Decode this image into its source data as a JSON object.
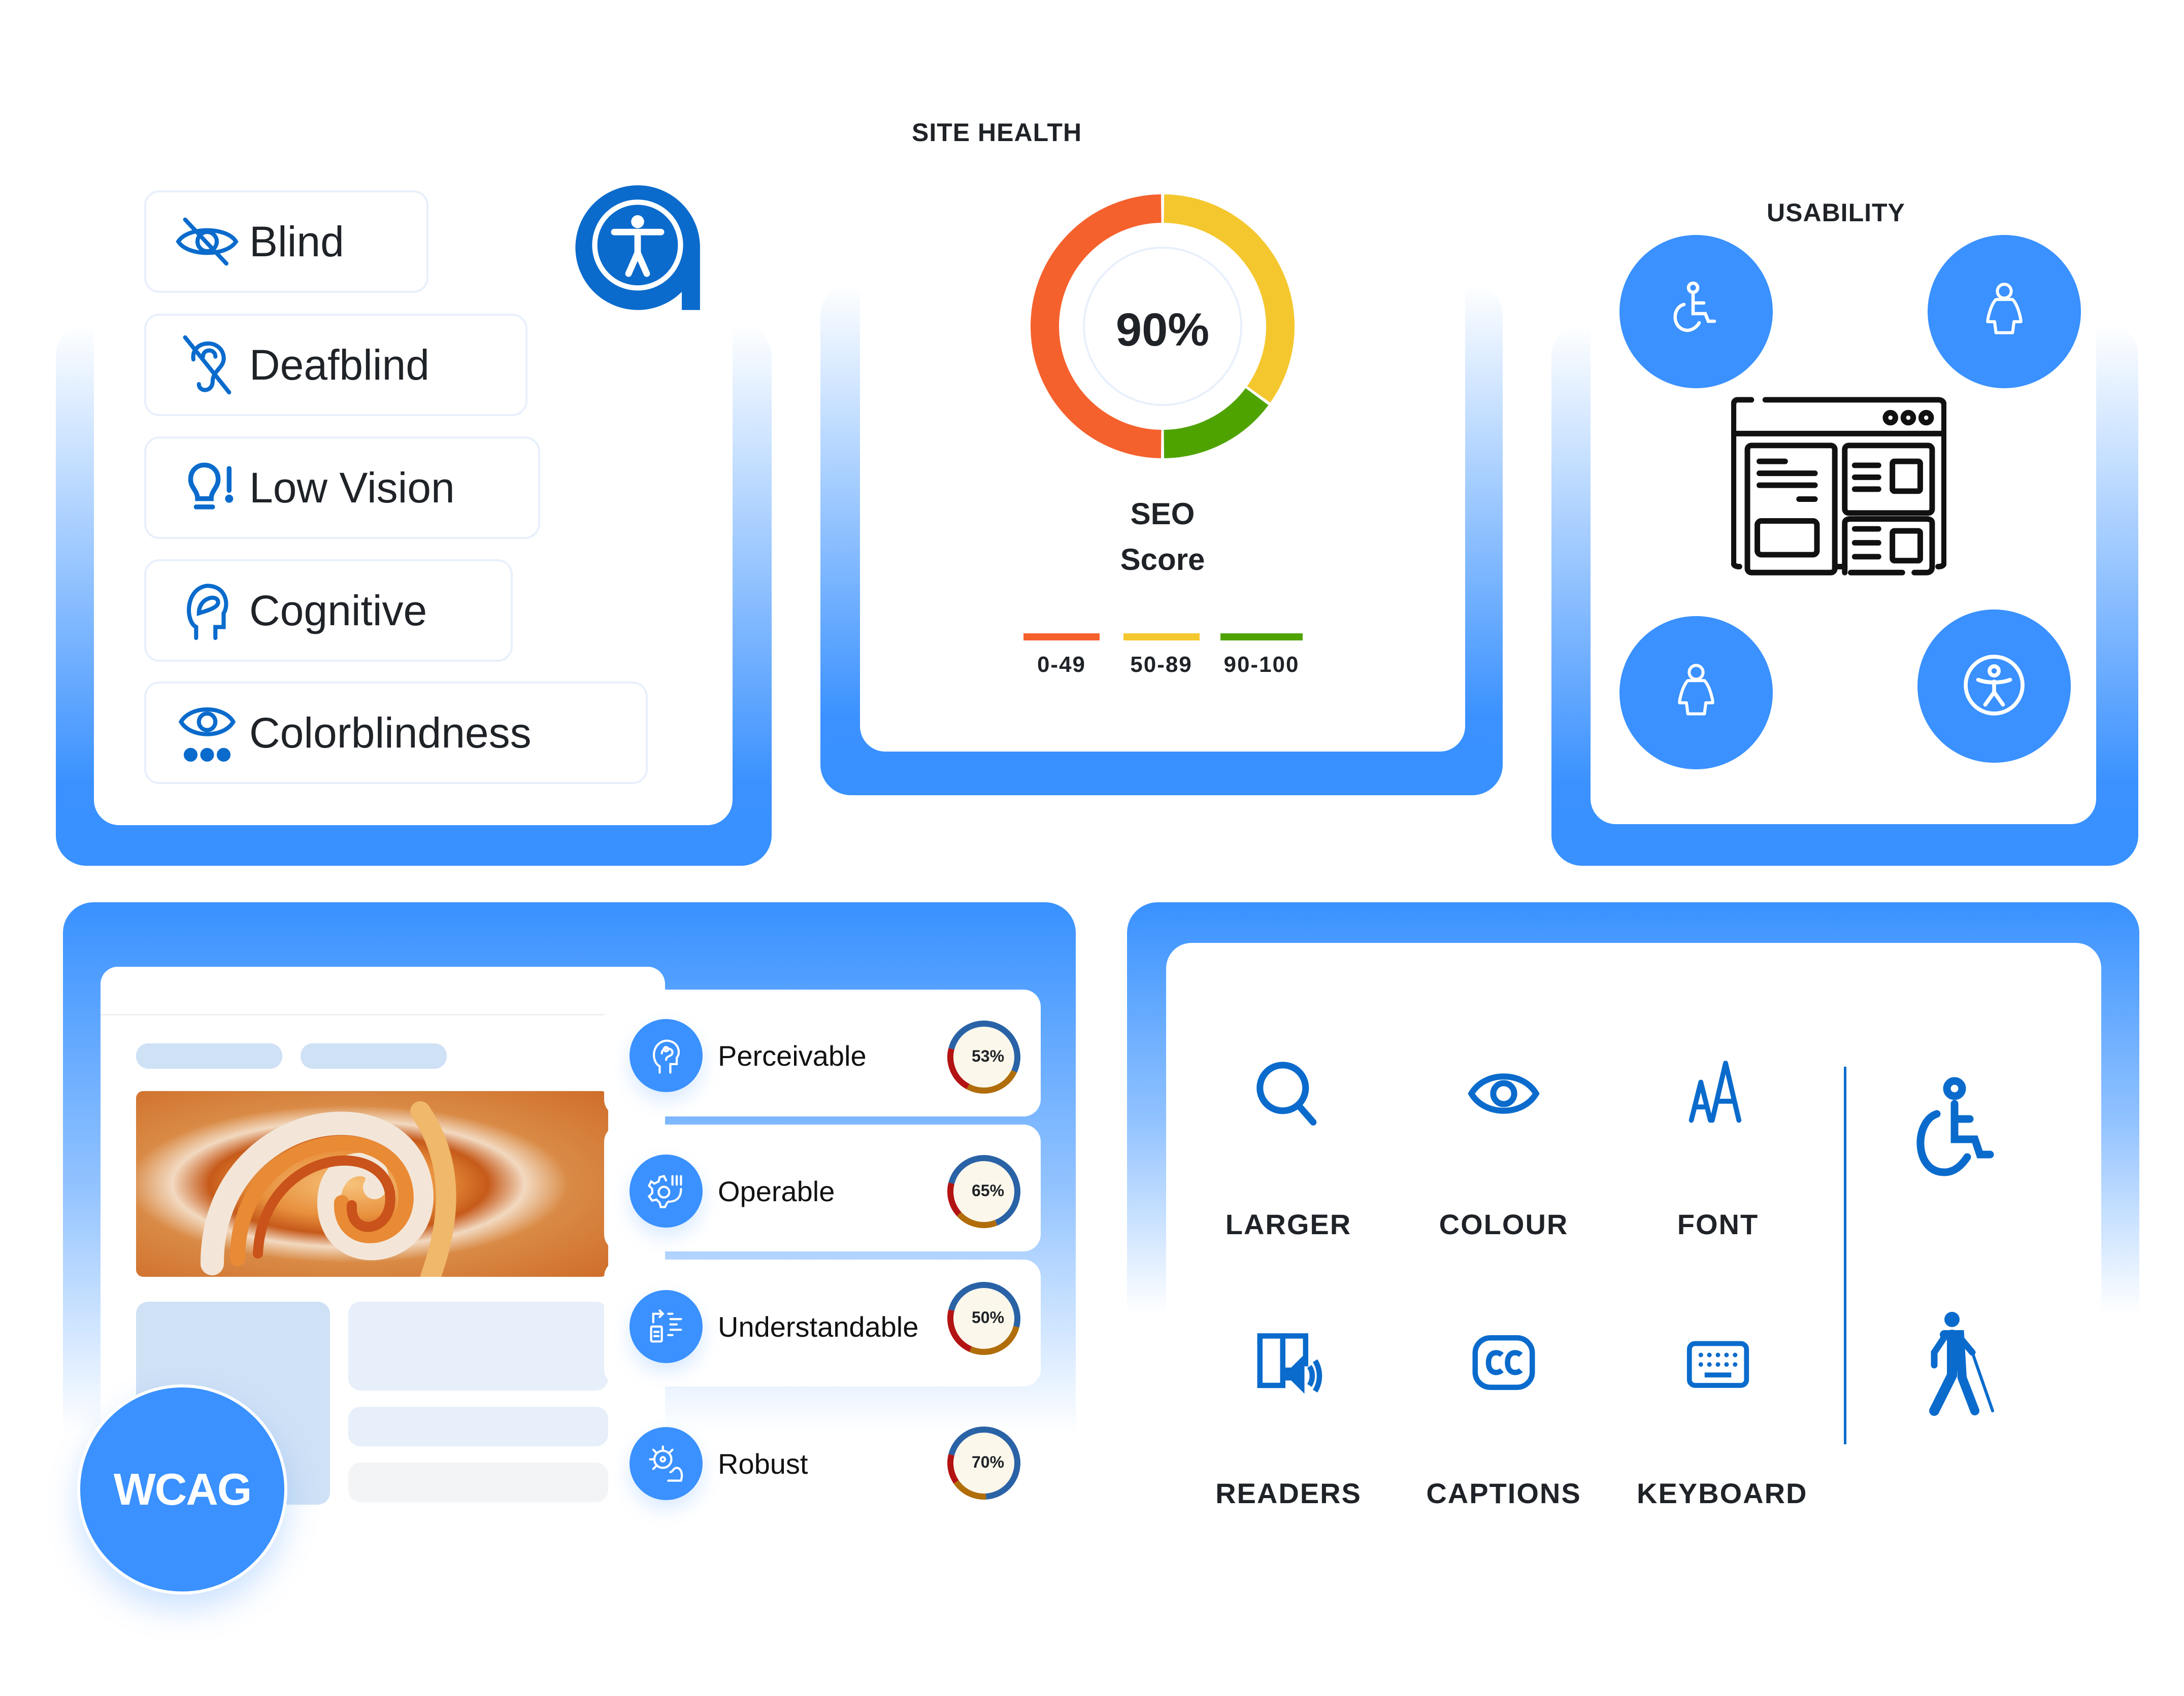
{
  "disabilities": {
    "items": [
      {
        "label": "Blind",
        "icon": "eye-slash-icon"
      },
      {
        "label": "Deafblind",
        "icon": "ear-slash-icon"
      },
      {
        "label": "Low Vision",
        "icon": "lightbulb-exclamation-icon"
      },
      {
        "label": "Cognitive",
        "icon": "head-brain-icon"
      },
      {
        "label": "Colorblindness",
        "icon": "eye-dots-icon"
      }
    ],
    "logo_icon": "accessibility-logo-icon"
  },
  "site_health": {
    "title": "SITE HEALTH",
    "score_text": "90%",
    "score_label_line1": "SEO",
    "score_label_line2": "Score",
    "legend": [
      {
        "label": "0-49",
        "color": "#f5612d"
      },
      {
        "label": "50-89",
        "color": "#f4c72e"
      },
      {
        "label": "90-100",
        "color": "#4fa300"
      }
    ]
  },
  "chart_data": {
    "type": "pie",
    "title": "SEO Score",
    "center_label": "90%",
    "categories": [
      "50-89",
      "90-100",
      "0-49"
    ],
    "values": [
      35,
      15,
      50
    ],
    "colors": [
      "#f4c72e",
      "#4fa300",
      "#f5612d"
    ],
    "legend": [
      "0-49",
      "50-89",
      "90-100"
    ],
    "legend_position": "bottom"
  },
  "usability": {
    "title": "USABILITY",
    "icons": [
      "wheelchair-icon",
      "person-icon",
      "person-icon",
      "accessibility-person-icon"
    ],
    "center_icon": "browser-layout-icon"
  },
  "wcag": {
    "badge": "WCAG",
    "principles": [
      {
        "label": "Perceivable",
        "percent": 53,
        "percent_text": "53%",
        "icon": "brain-head-icon"
      },
      {
        "label": "Operable",
        "percent": 65,
        "percent_text": "65%",
        "icon": "gear-hand-icon"
      },
      {
        "label": "Understandable",
        "percent": 50,
        "percent_text": "50%",
        "icon": "document-list-icon"
      },
      {
        "label": "Robust",
        "percent": 70,
        "percent_text": "70%",
        "icon": "virus-arm-icon"
      }
    ],
    "ring_colors": {
      "main": "#2a62a6",
      "secondary": "#b06d0a",
      "tertiary": "#b31313"
    }
  },
  "features": {
    "items": [
      {
        "label": "LARGER",
        "icon": "magnifier-icon"
      },
      {
        "label": "COLOUR",
        "icon": "eye-icon"
      },
      {
        "label": "FONT",
        "icon": "font-size-icon"
      },
      {
        "label": "READERS",
        "icon": "screen-reader-icon"
      },
      {
        "label": "CAPTIONS",
        "icon": "closed-captions-icon"
      },
      {
        "label": "KEYBOARD",
        "icon": "keyboard-icon"
      }
    ],
    "side_icons": [
      "wheelchair-icon",
      "blind-person-cane-icon"
    ]
  },
  "colors": {
    "accent": "#3a91ff",
    "icon_blue": "#0a6bcc",
    "text": "#1f2328"
  }
}
